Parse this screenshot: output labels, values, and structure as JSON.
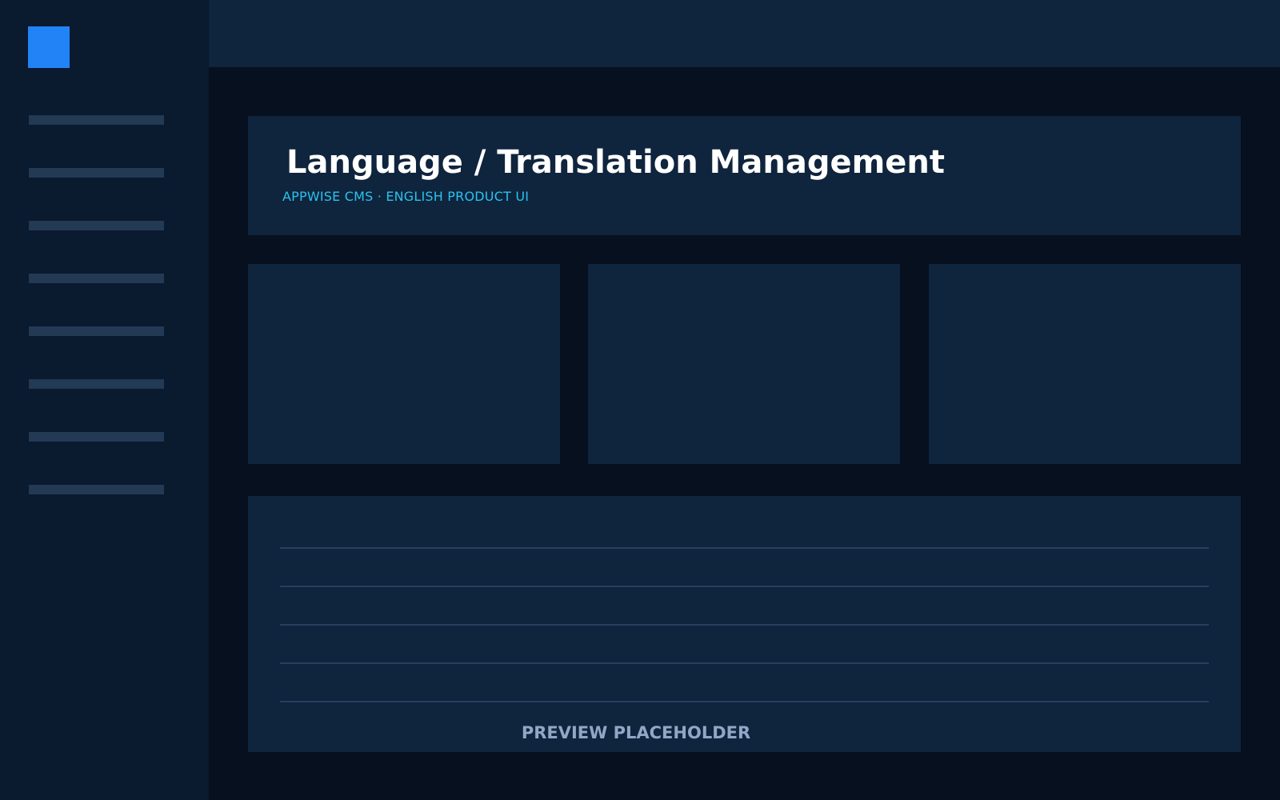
{
  "header": {
    "title": "Language / Translation Management",
    "subtitle": "APPWISE CMS · ENGLISH PRODUCT UI"
  },
  "preview": {
    "label": "PREVIEW PLACEHOLDER"
  },
  "colors": {
    "background": "#07101e",
    "sidebar": "#0a1a2f",
    "panel": "#0f243d",
    "accent": "#2283f6",
    "subtitle": "#29c3ee",
    "muted": "#90a8c6"
  }
}
